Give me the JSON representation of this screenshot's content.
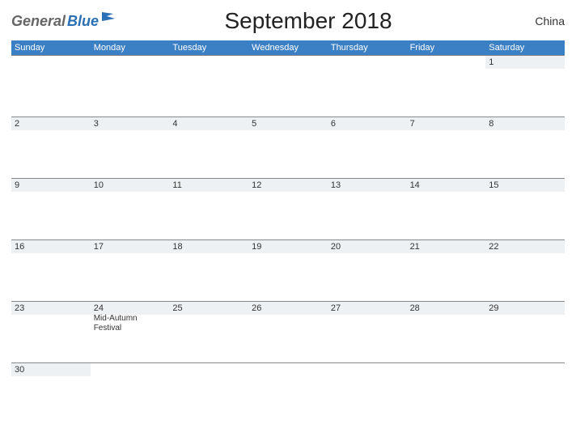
{
  "logo": {
    "part1": "General",
    "part2": "Blue"
  },
  "title": "September 2018",
  "region": "China",
  "day_headers": [
    "Sunday",
    "Monday",
    "Tuesday",
    "Wednesday",
    "Thursday",
    "Friday",
    "Saturday"
  ],
  "weeks": [
    [
      {
        "num": "",
        "event": ""
      },
      {
        "num": "",
        "event": ""
      },
      {
        "num": "",
        "event": ""
      },
      {
        "num": "",
        "event": ""
      },
      {
        "num": "",
        "event": ""
      },
      {
        "num": "",
        "event": ""
      },
      {
        "num": "1",
        "event": ""
      }
    ],
    [
      {
        "num": "2",
        "event": ""
      },
      {
        "num": "3",
        "event": ""
      },
      {
        "num": "4",
        "event": ""
      },
      {
        "num": "5",
        "event": ""
      },
      {
        "num": "6",
        "event": ""
      },
      {
        "num": "7",
        "event": ""
      },
      {
        "num": "8",
        "event": ""
      }
    ],
    [
      {
        "num": "9",
        "event": ""
      },
      {
        "num": "10",
        "event": ""
      },
      {
        "num": "11",
        "event": ""
      },
      {
        "num": "12",
        "event": ""
      },
      {
        "num": "13",
        "event": ""
      },
      {
        "num": "14",
        "event": ""
      },
      {
        "num": "15",
        "event": ""
      }
    ],
    [
      {
        "num": "16",
        "event": ""
      },
      {
        "num": "17",
        "event": ""
      },
      {
        "num": "18",
        "event": ""
      },
      {
        "num": "19",
        "event": ""
      },
      {
        "num": "20",
        "event": ""
      },
      {
        "num": "21",
        "event": ""
      },
      {
        "num": "22",
        "event": ""
      }
    ],
    [
      {
        "num": "23",
        "event": ""
      },
      {
        "num": "24",
        "event": "Mid-Autumn Festival"
      },
      {
        "num": "25",
        "event": ""
      },
      {
        "num": "26",
        "event": ""
      },
      {
        "num": "27",
        "event": ""
      },
      {
        "num": "28",
        "event": ""
      },
      {
        "num": "29",
        "event": ""
      }
    ],
    [
      {
        "num": "30",
        "event": ""
      },
      {
        "num": "",
        "event": ""
      },
      {
        "num": "",
        "event": ""
      },
      {
        "num": "",
        "event": ""
      },
      {
        "num": "",
        "event": ""
      },
      {
        "num": "",
        "event": ""
      },
      {
        "num": "",
        "event": ""
      }
    ]
  ]
}
